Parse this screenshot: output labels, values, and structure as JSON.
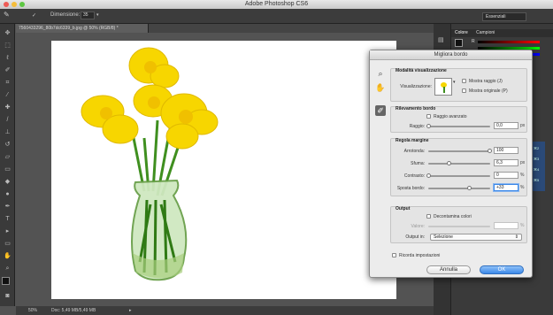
{
  "app": {
    "title": "Adobe Photoshop CS6"
  },
  "options_bar": {
    "size_label": "Dimensione:",
    "size_value": "35",
    "workspace": "Essenziali"
  },
  "document": {
    "tab_label": "7560433296_80b7dc6339_b.jpg @ 50% (RGB/8) *"
  },
  "status_bar": {
    "zoom": "50%",
    "doc_info": "Doc: 5,49 MB/5,49 MB"
  },
  "panels": {
    "tabs": [
      "Colore",
      "Campioni"
    ],
    "channel_labels": [
      "R",
      "⌘2",
      "⌘3",
      "⌘4",
      "⌘5"
    ]
  },
  "dialog": {
    "title": "Migliora bordo",
    "view_mode": {
      "title": "Modalità visualizzazione",
      "view_label": "Visualizzazione:",
      "show_radius": "Mostra raggio (J)",
      "show_original": "Mostra originale (P)"
    },
    "edge_detection": {
      "title": "Rilevamento bordo",
      "smart_radius": "Raggio avanzato",
      "radius_label": "Raggio:",
      "radius_value": "0,0",
      "radius_unit": "px"
    },
    "adjust_edge": {
      "title": "Regola margine",
      "smooth_label": "Arrotonda:",
      "smooth_value": "100",
      "feather_label": "Sfuma:",
      "feather_value": "6,3",
      "feather_unit": "px",
      "contrast_label": "Contrasto:",
      "contrast_value": "0",
      "contrast_unit": "%",
      "shift_label": "Sposta bordo:",
      "shift_value": "+33",
      "shift_unit": "%"
    },
    "output": {
      "title": "Output",
      "decontaminate": "Decontamina colori",
      "amount_label": "Valore:",
      "amount_unit": "%",
      "output_to_label": "Output in:",
      "output_to_value": "Selezione"
    },
    "remember": "Ricorda impostazioni",
    "cancel": "Annulla",
    "ok": "OK"
  },
  "colors": {
    "accent": "#3b88e8",
    "dialog_bg": "#ececec",
    "app_bg": "#535353"
  }
}
